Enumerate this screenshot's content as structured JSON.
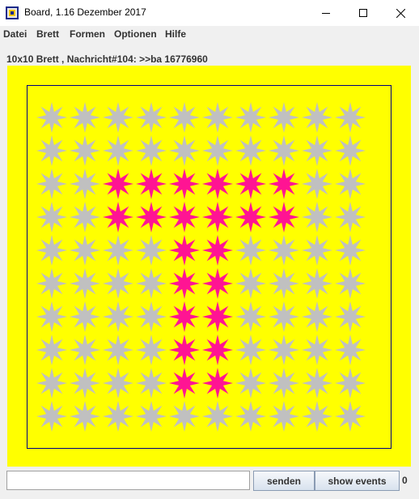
{
  "window": {
    "title": "Board, 1.16 Dezember 2017"
  },
  "menu": [
    {
      "label": "Datei"
    },
    {
      "label": "Brett"
    },
    {
      "label": "Formen"
    },
    {
      "label": "Optionen"
    },
    {
      "label": "Hilfe"
    }
  ],
  "status": "10x10 Brett , Nachricht#104: >>ba 16776960",
  "board": {
    "rows": 10,
    "cols": 10,
    "background_color": "#ffff00",
    "default_symbol_color": "#c0c0c0",
    "highlight_color": "#ff1493",
    "shape": "star",
    "highlighted_cells": [
      [
        2,
        2
      ],
      [
        2,
        3
      ],
      [
        2,
        4
      ],
      [
        2,
        5
      ],
      [
        2,
        6
      ],
      [
        2,
        7
      ],
      [
        3,
        2
      ],
      [
        3,
        3
      ],
      [
        3,
        4
      ],
      [
        3,
        5
      ],
      [
        3,
        6
      ],
      [
        3,
        7
      ],
      [
        4,
        4
      ],
      [
        4,
        5
      ],
      [
        5,
        4
      ],
      [
        5,
        5
      ],
      [
        6,
        4
      ],
      [
        6,
        5
      ],
      [
        7,
        4
      ],
      [
        7,
        5
      ],
      [
        8,
        4
      ],
      [
        8,
        5
      ]
    ]
  },
  "input": {
    "value": "",
    "placeholder": ""
  },
  "buttons": {
    "send": "senden",
    "show_events": "show events"
  },
  "event_count": "0"
}
